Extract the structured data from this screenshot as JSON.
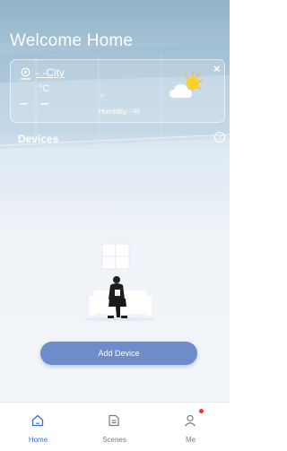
{
  "header": {
    "title": "Welcome Home"
  },
  "weather": {
    "city": "- -City",
    "unit": "°C",
    "temperature": "– –",
    "range": "-/-",
    "humidity": "Humidity:--%",
    "icon": "partly-sunny-icon"
  },
  "devices": {
    "label": "Devices",
    "add_button_label": "Add Device"
  },
  "tabbar": {
    "active": "Home",
    "items": [
      {
        "label": "Home",
        "icon": "home-icon"
      },
      {
        "label": "Scenes",
        "icon": "scenes-icon"
      },
      {
        "label": "Me",
        "icon": "profile-icon"
      }
    ]
  },
  "colors": {
    "accent": "#3b6fd6",
    "button": "#6e8cc9",
    "badge": "#e53935"
  }
}
